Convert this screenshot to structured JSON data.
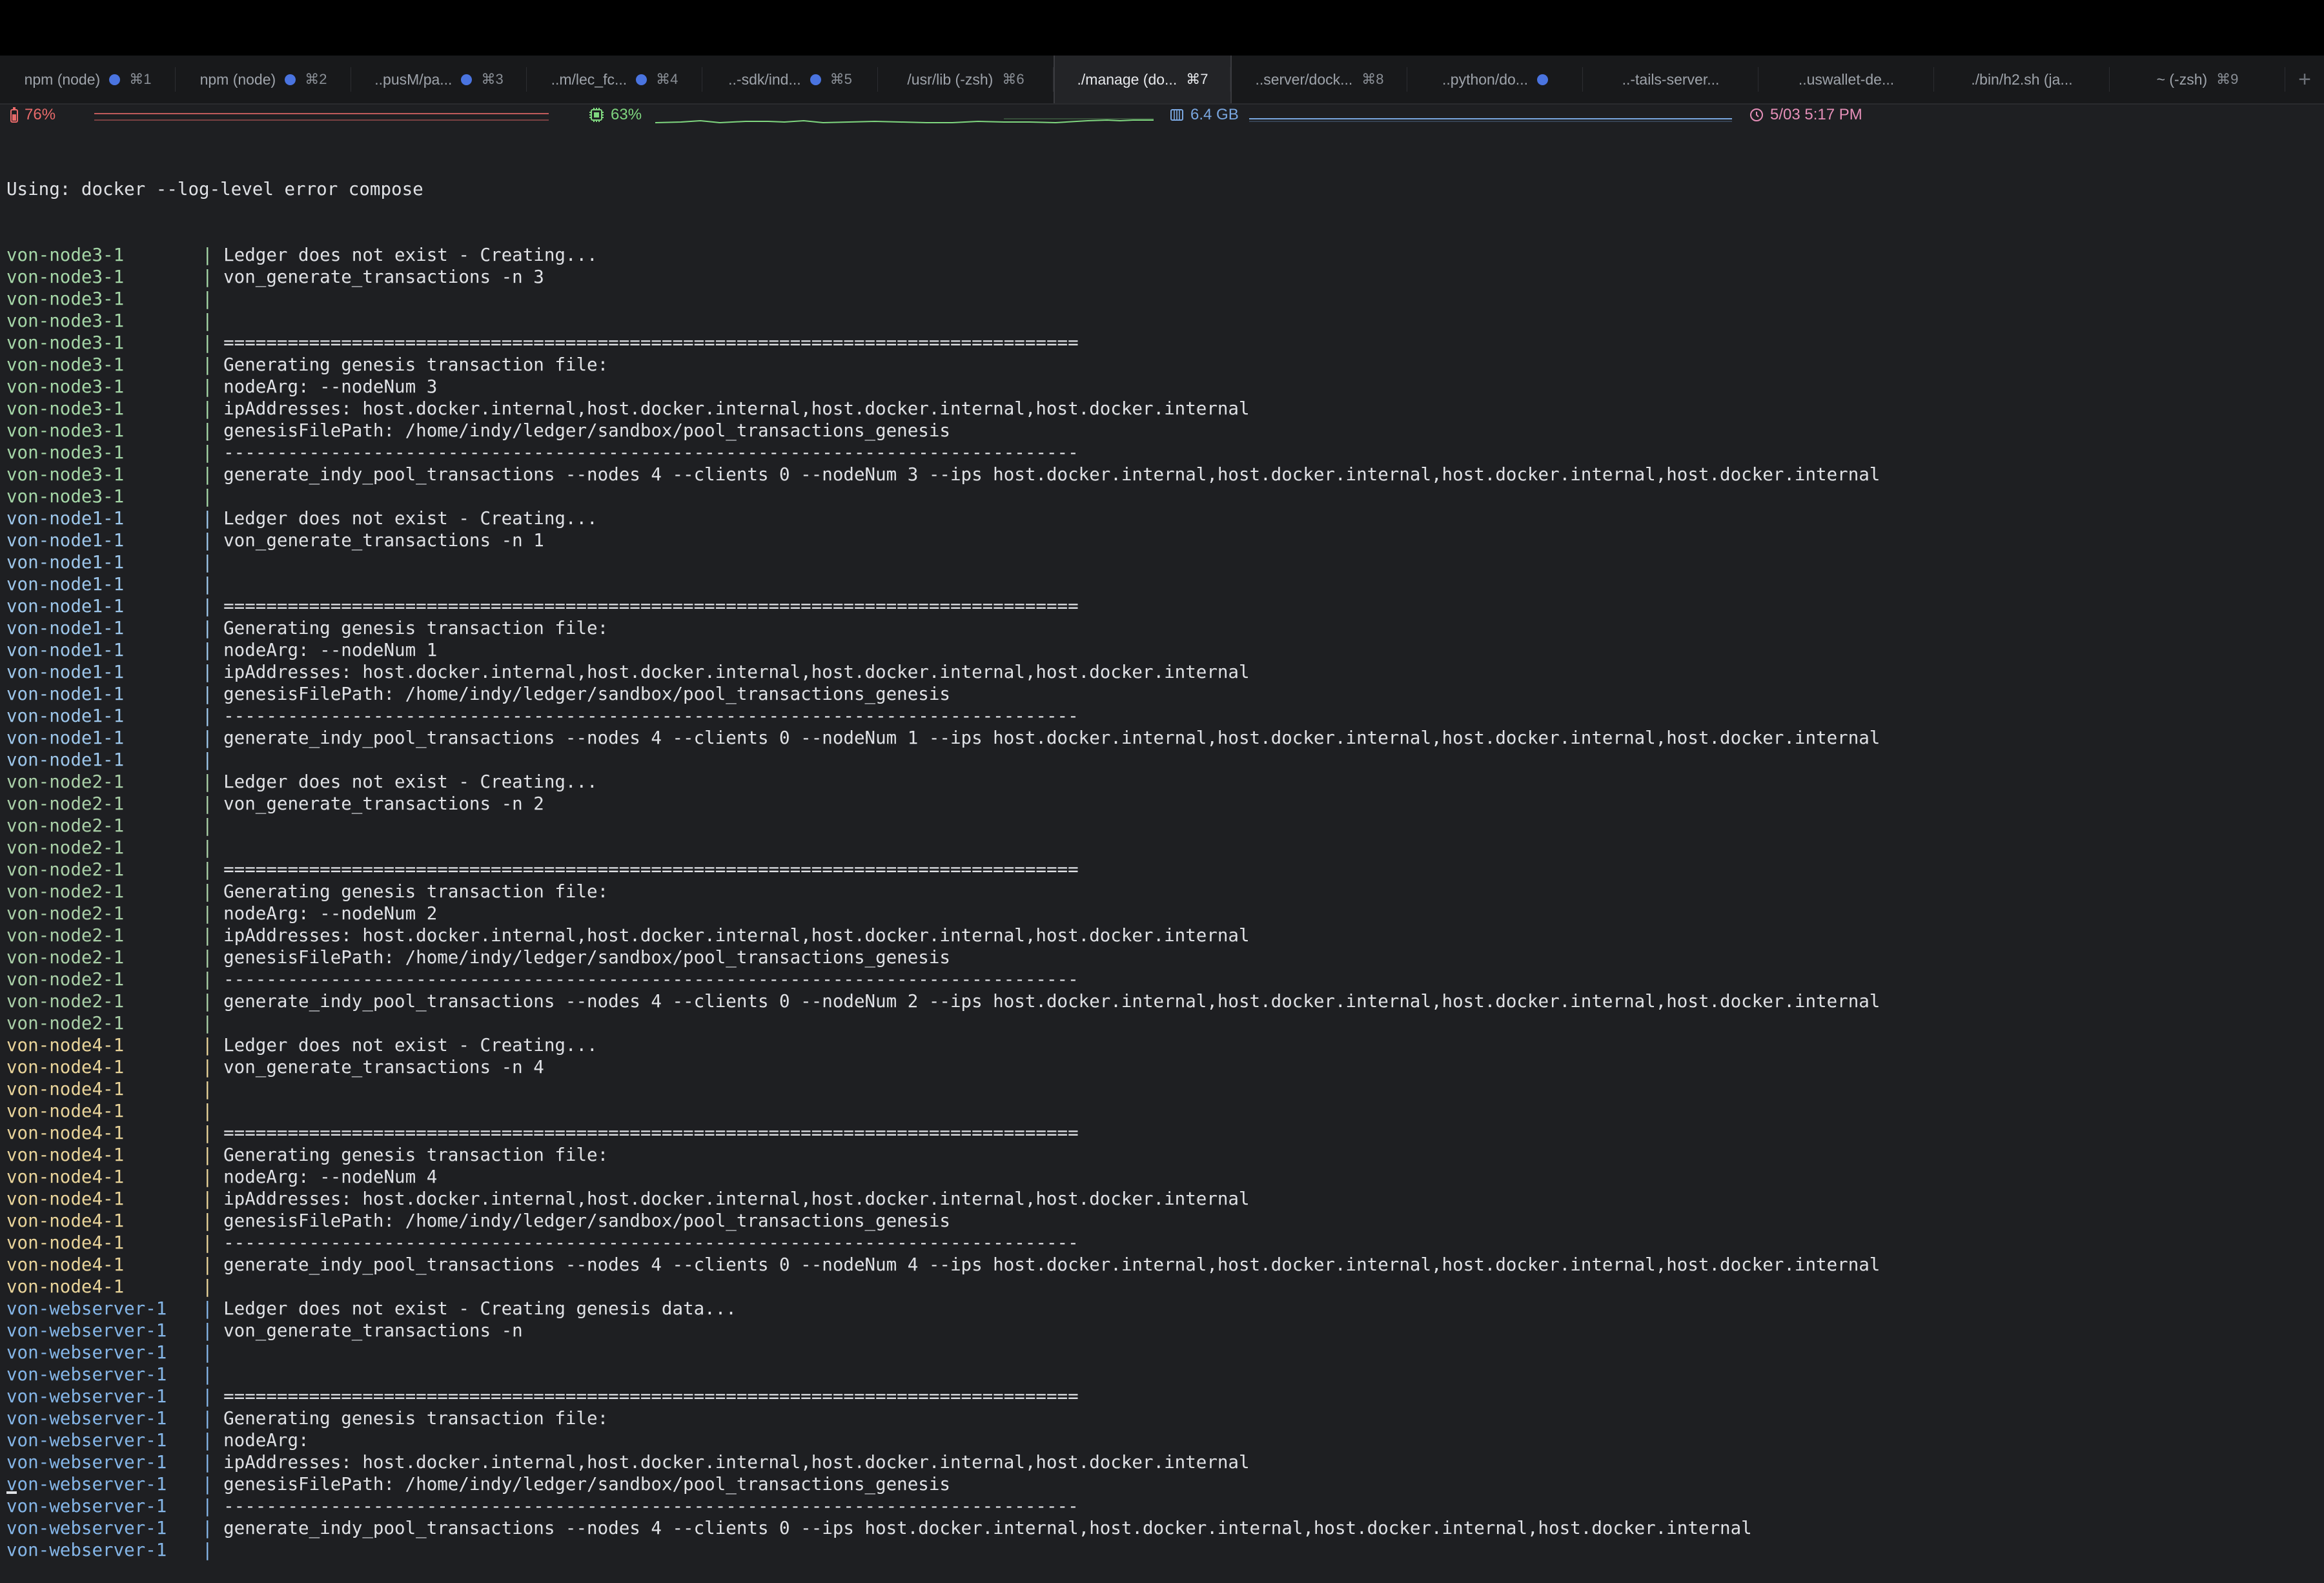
{
  "tabs": [
    {
      "label": "npm (node)",
      "dot": true,
      "shortcut": "⌘1",
      "active": false
    },
    {
      "label": "npm (node)",
      "dot": true,
      "shortcut": "⌘2",
      "active": false
    },
    {
      "label": "..pusM/pa...",
      "dot": true,
      "shortcut": "⌘3",
      "active": false
    },
    {
      "label": "..m/lec_fc...",
      "dot": true,
      "shortcut": "⌘4",
      "active": false
    },
    {
      "label": "..-sdk/ind...",
      "dot": true,
      "shortcut": "⌘5",
      "active": false
    },
    {
      "label": "/usr/lib (-zsh)",
      "dot": false,
      "shortcut": "⌘6",
      "active": false
    },
    {
      "label": "./manage (do...",
      "dot": false,
      "shortcut": "⌘7",
      "active": true
    },
    {
      "label": "..server/dock...",
      "dot": false,
      "shortcut": "⌘8",
      "active": false
    },
    {
      "label": "..python/do...",
      "dot": true,
      "shortcut": "",
      "active": false
    },
    {
      "label": "..-tails-server...",
      "dot": false,
      "shortcut": "",
      "active": false
    },
    {
      "label": "..uswallet-de...",
      "dot": false,
      "shortcut": "",
      "active": false
    },
    {
      "label": "./bin/h2.sh (ja...",
      "dot": false,
      "shortcut": "",
      "active": false
    },
    {
      "label": "~ (-zsh)",
      "dot": false,
      "shortcut": "⌘9",
      "active": false
    }
  ],
  "status": {
    "battery": "76%",
    "cpu": "63%",
    "memory": "6.4 GB",
    "datetime": "5/03 5:17 PM",
    "battery_level": 0.76,
    "colors": {
      "battery": "#e86a6a",
      "cpu": "#7fd67f",
      "memory": "#7aa7e0",
      "clock": "#e58fb8"
    }
  },
  "terminal": {
    "header": "Using: docker --log-level error compose",
    "lines": [
      {
        "p": "von-node3-1",
        "c": "node3",
        "t": "Ledger does not exist - Creating..."
      },
      {
        "p": "von-node3-1",
        "c": "node3",
        "t": "von_generate_transactions -n 3"
      },
      {
        "p": "von-node3-1",
        "c": "node3",
        "t": ""
      },
      {
        "p": "von-node3-1",
        "c": "node3",
        "t": ""
      },
      {
        "p": "von-node3-1",
        "c": "node3",
        "t": "================================================================================"
      },
      {
        "p": "von-node3-1",
        "c": "node3",
        "t": "Generating genesis transaction file:"
      },
      {
        "p": "von-node3-1",
        "c": "node3",
        "t": "nodeArg: --nodeNum 3"
      },
      {
        "p": "von-node3-1",
        "c": "node3",
        "t": "ipAddresses: host.docker.internal,host.docker.internal,host.docker.internal,host.docker.internal"
      },
      {
        "p": "von-node3-1",
        "c": "node3",
        "t": "genesisFilePath: /home/indy/ledger/sandbox/pool_transactions_genesis"
      },
      {
        "p": "von-node3-1",
        "c": "node3",
        "t": "--------------------------------------------------------------------------------"
      },
      {
        "p": "von-node3-1",
        "c": "node3",
        "t": "generate_indy_pool_transactions --nodes 4 --clients 0 --nodeNum 3 --ips host.docker.internal,host.docker.internal,host.docker.internal,host.docker.internal"
      },
      {
        "p": "von-node3-1",
        "c": "node3",
        "t": ""
      },
      {
        "p": "von-node1-1",
        "c": "node1",
        "t": "Ledger does not exist - Creating..."
      },
      {
        "p": "von-node1-1",
        "c": "node1",
        "t": "von_generate_transactions -n 1"
      },
      {
        "p": "von-node1-1",
        "c": "node1",
        "t": ""
      },
      {
        "p": "von-node1-1",
        "c": "node1",
        "t": ""
      },
      {
        "p": "von-node1-1",
        "c": "node1",
        "t": "================================================================================"
      },
      {
        "p": "von-node1-1",
        "c": "node1",
        "t": "Generating genesis transaction file:"
      },
      {
        "p": "von-node1-1",
        "c": "node1",
        "t": "nodeArg: --nodeNum 1"
      },
      {
        "p": "von-node1-1",
        "c": "node1",
        "t": "ipAddresses: host.docker.internal,host.docker.internal,host.docker.internal,host.docker.internal"
      },
      {
        "p": "von-node1-1",
        "c": "node1",
        "t": "genesisFilePath: /home/indy/ledger/sandbox/pool_transactions_genesis"
      },
      {
        "p": "von-node1-1",
        "c": "node1",
        "t": "--------------------------------------------------------------------------------"
      },
      {
        "p": "von-node1-1",
        "c": "node1",
        "t": "generate_indy_pool_transactions --nodes 4 --clients 0 --nodeNum 1 --ips host.docker.internal,host.docker.internal,host.docker.internal,host.docker.internal"
      },
      {
        "p": "von-node1-1",
        "c": "node1",
        "t": ""
      },
      {
        "p": "von-node2-1",
        "c": "node2",
        "t": "Ledger does not exist - Creating..."
      },
      {
        "p": "von-node2-1",
        "c": "node2",
        "t": "von_generate_transactions -n 2"
      },
      {
        "p": "von-node2-1",
        "c": "node2",
        "t": ""
      },
      {
        "p": "von-node2-1",
        "c": "node2",
        "t": ""
      },
      {
        "p": "von-node2-1",
        "c": "node2",
        "t": "================================================================================"
      },
      {
        "p": "von-node2-1",
        "c": "node2",
        "t": "Generating genesis transaction file:"
      },
      {
        "p": "von-node2-1",
        "c": "node2",
        "t": "nodeArg: --nodeNum 2"
      },
      {
        "p": "von-node2-1",
        "c": "node2",
        "t": "ipAddresses: host.docker.internal,host.docker.internal,host.docker.internal,host.docker.internal"
      },
      {
        "p": "von-node2-1",
        "c": "node2",
        "t": "genesisFilePath: /home/indy/ledger/sandbox/pool_transactions_genesis"
      },
      {
        "p": "von-node2-1",
        "c": "node2",
        "t": "--------------------------------------------------------------------------------"
      },
      {
        "p": "von-node2-1",
        "c": "node2",
        "t": "generate_indy_pool_transactions --nodes 4 --clients 0 --nodeNum 2 --ips host.docker.internal,host.docker.internal,host.docker.internal,host.docker.internal"
      },
      {
        "p": "von-node2-1",
        "c": "node2",
        "t": ""
      },
      {
        "p": "von-node4-1",
        "c": "node4",
        "t": "Ledger does not exist - Creating..."
      },
      {
        "p": "von-node4-1",
        "c": "node4",
        "t": "von_generate_transactions -n 4"
      },
      {
        "p": "von-node4-1",
        "c": "node4",
        "t": ""
      },
      {
        "p": "von-node4-1",
        "c": "node4",
        "t": ""
      },
      {
        "p": "von-node4-1",
        "c": "node4",
        "t": "================================================================================"
      },
      {
        "p": "von-node4-1",
        "c": "node4",
        "t": "Generating genesis transaction file:"
      },
      {
        "p": "von-node4-1",
        "c": "node4",
        "t": "nodeArg: --nodeNum 4"
      },
      {
        "p": "von-node4-1",
        "c": "node4",
        "t": "ipAddresses: host.docker.internal,host.docker.internal,host.docker.internal,host.docker.internal"
      },
      {
        "p": "von-node4-1",
        "c": "node4",
        "t": "genesisFilePath: /home/indy/ledger/sandbox/pool_transactions_genesis"
      },
      {
        "p": "von-node4-1",
        "c": "node4",
        "t": "--------------------------------------------------------------------------------"
      },
      {
        "p": "von-node4-1",
        "c": "node4",
        "t": "generate_indy_pool_transactions --nodes 4 --clients 0 --nodeNum 4 --ips host.docker.internal,host.docker.internal,host.docker.internal,host.docker.internal"
      },
      {
        "p": "von-node4-1",
        "c": "node4",
        "t": ""
      },
      {
        "p": "von-webserver-1",
        "c": "web",
        "t": "Ledger does not exist - Creating genesis data..."
      },
      {
        "p": "von-webserver-1",
        "c": "web",
        "t": "von_generate_transactions -n"
      },
      {
        "p": "von-webserver-1",
        "c": "web",
        "t": ""
      },
      {
        "p": "von-webserver-1",
        "c": "web",
        "t": ""
      },
      {
        "p": "von-webserver-1",
        "c": "web",
        "t": "================================================================================"
      },
      {
        "p": "von-webserver-1",
        "c": "web",
        "t": "Generating genesis transaction file:"
      },
      {
        "p": "von-webserver-1",
        "c": "web",
        "t": "nodeArg:"
      },
      {
        "p": "von-webserver-1",
        "c": "web",
        "t": "ipAddresses: host.docker.internal,host.docker.internal,host.docker.internal,host.docker.internal"
      },
      {
        "p": "von-webserver-1",
        "c": "web",
        "t": "genesisFilePath: /home/indy/ledger/sandbox/pool_transactions_genesis"
      },
      {
        "p": "von-webserver-1",
        "c": "web",
        "t": "--------------------------------------------------------------------------------"
      },
      {
        "p": "von-webserver-1",
        "c": "web",
        "t": "generate_indy_pool_transactions --nodes 4 --clients 0 --ips host.docker.internal,host.docker.internal,host.docker.internal,host.docker.internal"
      },
      {
        "p": "von-webserver-1",
        "c": "web",
        "t": ""
      }
    ]
  }
}
